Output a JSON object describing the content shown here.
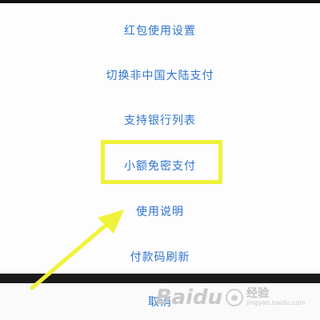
{
  "menu": {
    "items": [
      {
        "label": "红包使用设置"
      },
      {
        "label": "切换非中国大陆支付"
      },
      {
        "label": "支持银行列表"
      },
      {
        "label": "小额免密支付",
        "highlighted": true
      },
      {
        "label": "使用说明"
      },
      {
        "label": "付款码刷新"
      }
    ],
    "cancel_label": "取消"
  },
  "annotation": {
    "highlight_color": "#f0f23a",
    "arrow_color": "#f0f23a"
  },
  "watermark": {
    "logo": "Baidu",
    "name": "经验",
    "url": "jingyan.baidu.com"
  },
  "colors": {
    "menu_text": "#2f74d0",
    "background": "#fafafa",
    "bottom_bar": "#1b1b1b"
  }
}
